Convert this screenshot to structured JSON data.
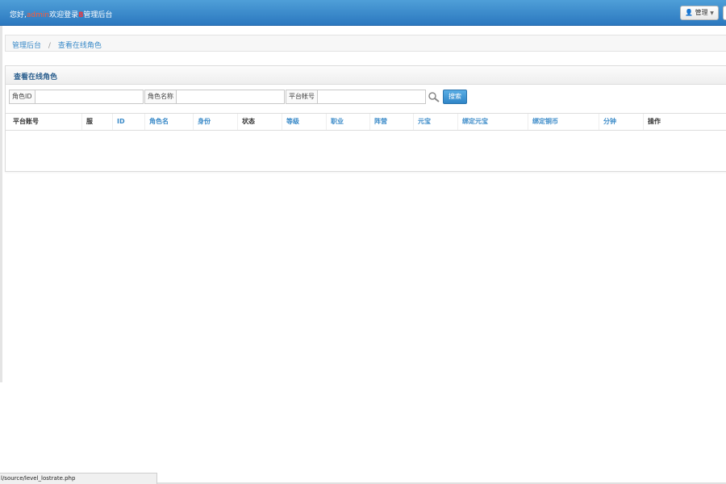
{
  "navbar": {
    "greeting_prefix": "您好,",
    "username": "admin",
    "greeting_mid": "欢迎登录",
    "mark": "8",
    "greeting_suffix": "管理后台",
    "manage_label": "管理"
  },
  "breadcrumb": {
    "items": [
      "管理后台",
      "查看在线角色"
    ],
    "separator": "/"
  },
  "panel": {
    "title": "查看在线角色"
  },
  "search": {
    "fields": [
      {
        "label": "角色ID",
        "value": ""
      },
      {
        "label": "角色名称",
        "value": ""
      },
      {
        "label": "平台帐号",
        "value": ""
      }
    ],
    "button_label": "搜索"
  },
  "table": {
    "columns": [
      {
        "label": "平台账号",
        "sortable": false
      },
      {
        "label": "服",
        "sortable": false
      },
      {
        "label": "ID",
        "sortable": true
      },
      {
        "label": "角色名",
        "sortable": true
      },
      {
        "label": "身份",
        "sortable": true
      },
      {
        "label": "状态",
        "sortable": false
      },
      {
        "label": "等级",
        "sortable": true
      },
      {
        "label": "职业",
        "sortable": true
      },
      {
        "label": "阵营",
        "sortable": true
      },
      {
        "label": "元宝",
        "sortable": true
      },
      {
        "label": "绑定元宝",
        "sortable": true
      },
      {
        "label": "绑定铜币",
        "sortable": true
      },
      {
        "label": "分钟",
        "sortable": true
      },
      {
        "label": "操作",
        "sortable": false
      }
    ],
    "rows": []
  },
  "statusbar": {
    "text": "l/source/level_lostrate.php"
  },
  "colors": {
    "navbar": "#2b78bf",
    "link": "#3a8ac8",
    "username": "#ff5a36",
    "button": "#2f85c8"
  }
}
